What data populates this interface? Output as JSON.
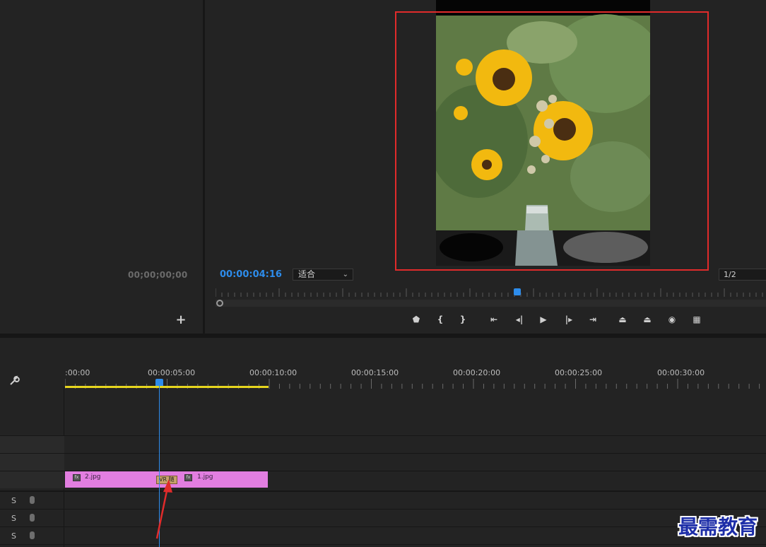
{
  "source_monitor": {
    "timecode": "00;00;00;00",
    "add_button": "+"
  },
  "program_monitor": {
    "timecode": "00:00:04:16",
    "zoom": "适合",
    "resolution": "1/2"
  },
  "transport": {
    "buttons": [
      {
        "icon": "marker-icon",
        "glyph": "⬟"
      },
      {
        "icon": "mark-in-icon",
        "glyph": "{"
      },
      {
        "icon": "mark-out-icon",
        "glyph": "}"
      },
      {
        "icon": "go-to-in-icon",
        "glyph": "⇤"
      },
      {
        "icon": "step-back-icon",
        "glyph": "◂|"
      },
      {
        "icon": "play-icon",
        "glyph": "▶"
      },
      {
        "icon": "step-forward-icon",
        "glyph": "|▸"
      },
      {
        "icon": "go-to-out-icon",
        "glyph": "⇥"
      },
      {
        "icon": "lift-icon",
        "glyph": "⏏"
      },
      {
        "icon": "extract-icon",
        "glyph": "⏏"
      },
      {
        "icon": "export-frame-icon",
        "glyph": "◉"
      },
      {
        "icon": "comparison-view-icon",
        "glyph": "▦"
      }
    ]
  },
  "timeline": {
    "ruler_labels": [
      ":00:00",
      "00:00:05:00",
      "00:00:10:00",
      "00:00:15:00",
      "00:00:20:00",
      "00:00:25:00",
      "00:00:30:00"
    ],
    "clips": [
      {
        "label": "2.jpg",
        "color": "#e27ee0"
      },
      {
        "label": "1.jpg",
        "color": "#e27ee0"
      }
    ],
    "transition_label": "VR 随",
    "audio_solo": "S"
  },
  "watermark": "最需教育",
  "colors": {
    "accent": "#2d8ceb",
    "highlight": "#e02b2b",
    "work_area": "#e6d51e"
  }
}
